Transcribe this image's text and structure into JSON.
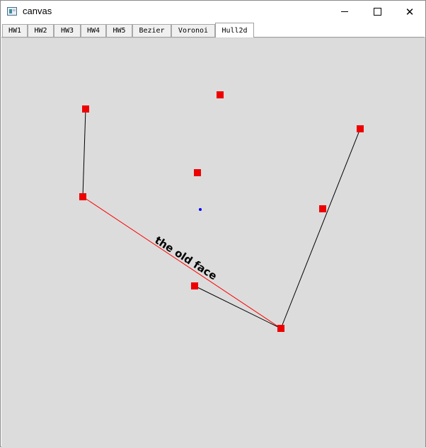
{
  "window": {
    "title": "canvas",
    "minimize_icon": "minimize-icon",
    "maximize_icon": "maximize-icon",
    "close_icon": "close-icon",
    "close_glyph": "✕"
  },
  "tabs": [
    {
      "label": "HW1"
    },
    {
      "label": "HW2"
    },
    {
      "label": "HW3"
    },
    {
      "label": "HW4"
    },
    {
      "label": "HW5"
    },
    {
      "label": "Bezier"
    },
    {
      "label": "Voronoi"
    },
    {
      "label": "Hull2d",
      "active": true
    }
  ],
  "canvas": {
    "annotation": "the old face",
    "colors": {
      "background": "#dcdcdc",
      "point": "#ee0000",
      "edge": "#000000",
      "old_face": "#ff0000",
      "centroid": "#0000ff"
    }
  }
}
